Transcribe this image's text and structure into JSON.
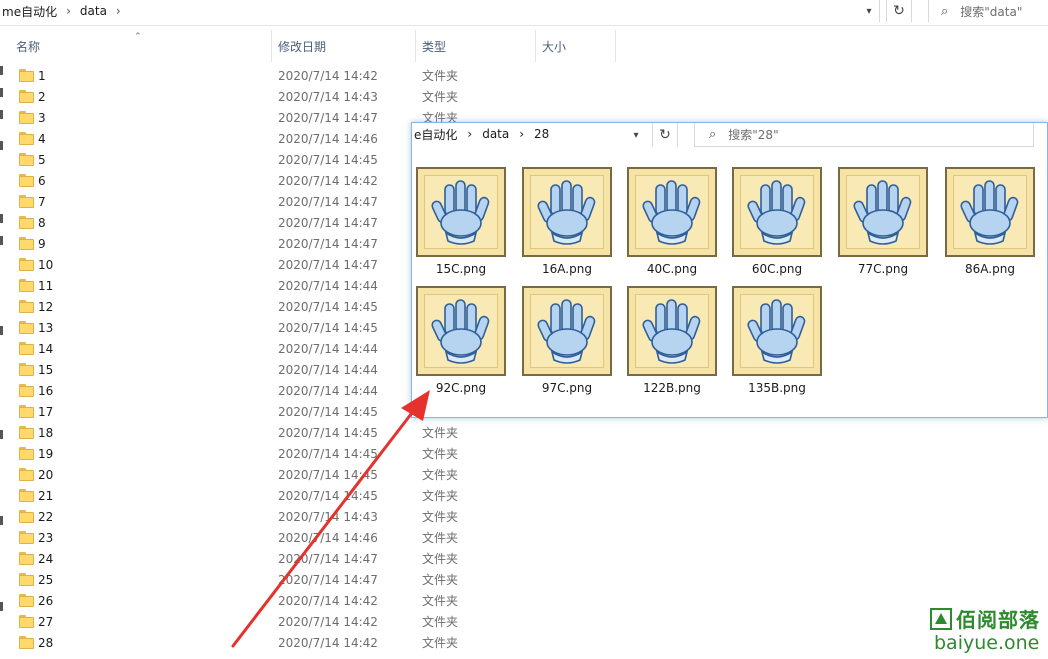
{
  "main": {
    "breadcrumb": [
      "me自动化",
      "data"
    ],
    "search_placeholder": "搜索\"data\"",
    "columns": {
      "name": "名称",
      "date": "修改日期",
      "type": "类型",
      "size": "大小"
    },
    "rows": [
      {
        "name": "1",
        "date": "2020/7/14 14:42",
        "type": "文件夹"
      },
      {
        "name": "2",
        "date": "2020/7/14 14:43",
        "type": "文件夹"
      },
      {
        "name": "3",
        "date": "2020/7/14 14:47",
        "type": "文件夹"
      },
      {
        "name": "4",
        "date": "2020/7/14 14:46",
        "type": ""
      },
      {
        "name": "5",
        "date": "2020/7/14 14:45",
        "type": ""
      },
      {
        "name": "6",
        "date": "2020/7/14 14:42",
        "type": ""
      },
      {
        "name": "7",
        "date": "2020/7/14 14:47",
        "type": ""
      },
      {
        "name": "8",
        "date": "2020/7/14 14:47",
        "type": ""
      },
      {
        "name": "9",
        "date": "2020/7/14 14:47",
        "type": ""
      },
      {
        "name": "10",
        "date": "2020/7/14 14:47",
        "type": ""
      },
      {
        "name": "11",
        "date": "2020/7/14 14:44",
        "type": ""
      },
      {
        "name": "12",
        "date": "2020/7/14 14:45",
        "type": ""
      },
      {
        "name": "13",
        "date": "2020/7/14 14:45",
        "type": ""
      },
      {
        "name": "14",
        "date": "2020/7/14 14:44",
        "type": ""
      },
      {
        "name": "15",
        "date": "2020/7/14 14:44",
        "type": ""
      },
      {
        "name": "16",
        "date": "2020/7/14 14:44",
        "type": ""
      },
      {
        "name": "17",
        "date": "2020/7/14 14:45",
        "type": ""
      },
      {
        "name": "18",
        "date": "2020/7/14 14:45",
        "type": "文件夹"
      },
      {
        "name": "19",
        "date": "2020/7/14 14:45",
        "type": "文件夹"
      },
      {
        "name": "20",
        "date": "2020/7/14 14:45",
        "type": "文件夹"
      },
      {
        "name": "21",
        "date": "2020/7/14 14:45",
        "type": "文件夹"
      },
      {
        "name": "22",
        "date": "2020/7/14 14:43",
        "type": "文件夹"
      },
      {
        "name": "23",
        "date": "2020/7/14 14:46",
        "type": "文件夹"
      },
      {
        "name": "24",
        "date": "2020/7/14 14:47",
        "type": "文件夹"
      },
      {
        "name": "25",
        "date": "2020/7/14 14:47",
        "type": "文件夹"
      },
      {
        "name": "26",
        "date": "2020/7/14 14:42",
        "type": "文件夹"
      },
      {
        "name": "27",
        "date": "2020/7/14 14:42",
        "type": "文件夹"
      },
      {
        "name": "28",
        "date": "2020/7/14 14:42",
        "type": "文件夹"
      }
    ]
  },
  "overlay": {
    "breadcrumb": [
      "e自动化",
      "data",
      "28"
    ],
    "search_placeholder": "搜索\"28\"",
    "files": [
      "15C.png",
      "16A.png",
      "40C.png",
      "60C.png",
      "77C.png",
      "86A.png",
      "92C.png",
      "97C.png",
      "122B.png",
      "135B.png"
    ]
  },
  "watermark": {
    "name": "佰阅部落",
    "url": "baiyue.one"
  },
  "colors": {
    "arrow": "#e5322d",
    "watermark": "#2e8a2e",
    "folder": "#ffd96a",
    "header_text": "#4c607a"
  }
}
